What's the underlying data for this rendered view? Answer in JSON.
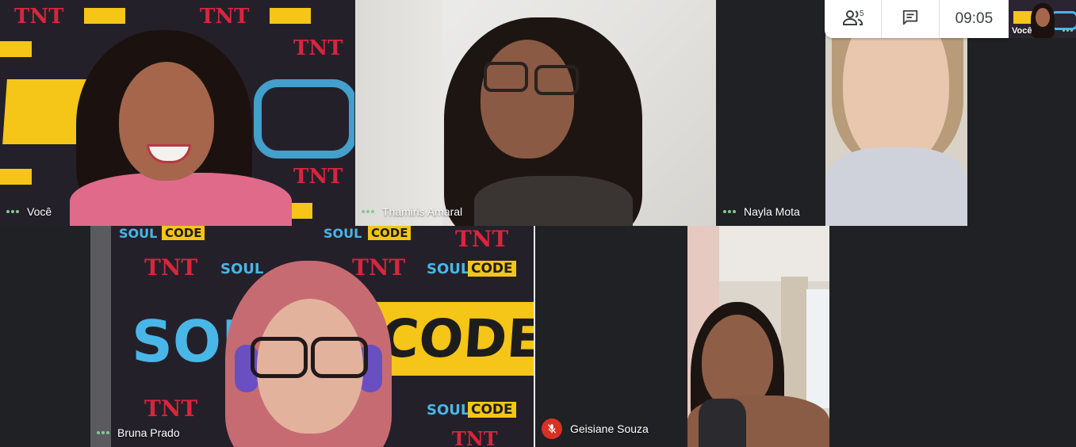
{
  "meeting": {
    "participant_count": "5",
    "clock": "09:05"
  },
  "icons": {
    "people": "people-icon",
    "chat": "chat-icon",
    "mic_off": "mic-off-icon",
    "more": "more-options-icon"
  },
  "colors": {
    "background": "#202124",
    "active_dots": "#81c995",
    "mic_off": "#d93025",
    "brand_yellow": "#f5c518",
    "brand_blue": "#49b6e8",
    "brand_red": "#d7263d"
  },
  "self_view": {
    "label": "Você"
  },
  "tiles": [
    {
      "name": "Você"
    },
    {
      "name": "Thamiris Amaral"
    },
    {
      "name": "Nayla Mota"
    },
    {
      "name": "Bruna Prado"
    },
    {
      "name": "Geisiane Souza"
    }
  ],
  "backdrop": {
    "brand_left": "SOUL",
    "brand_right": "CODE",
    "logo": "TNT"
  }
}
